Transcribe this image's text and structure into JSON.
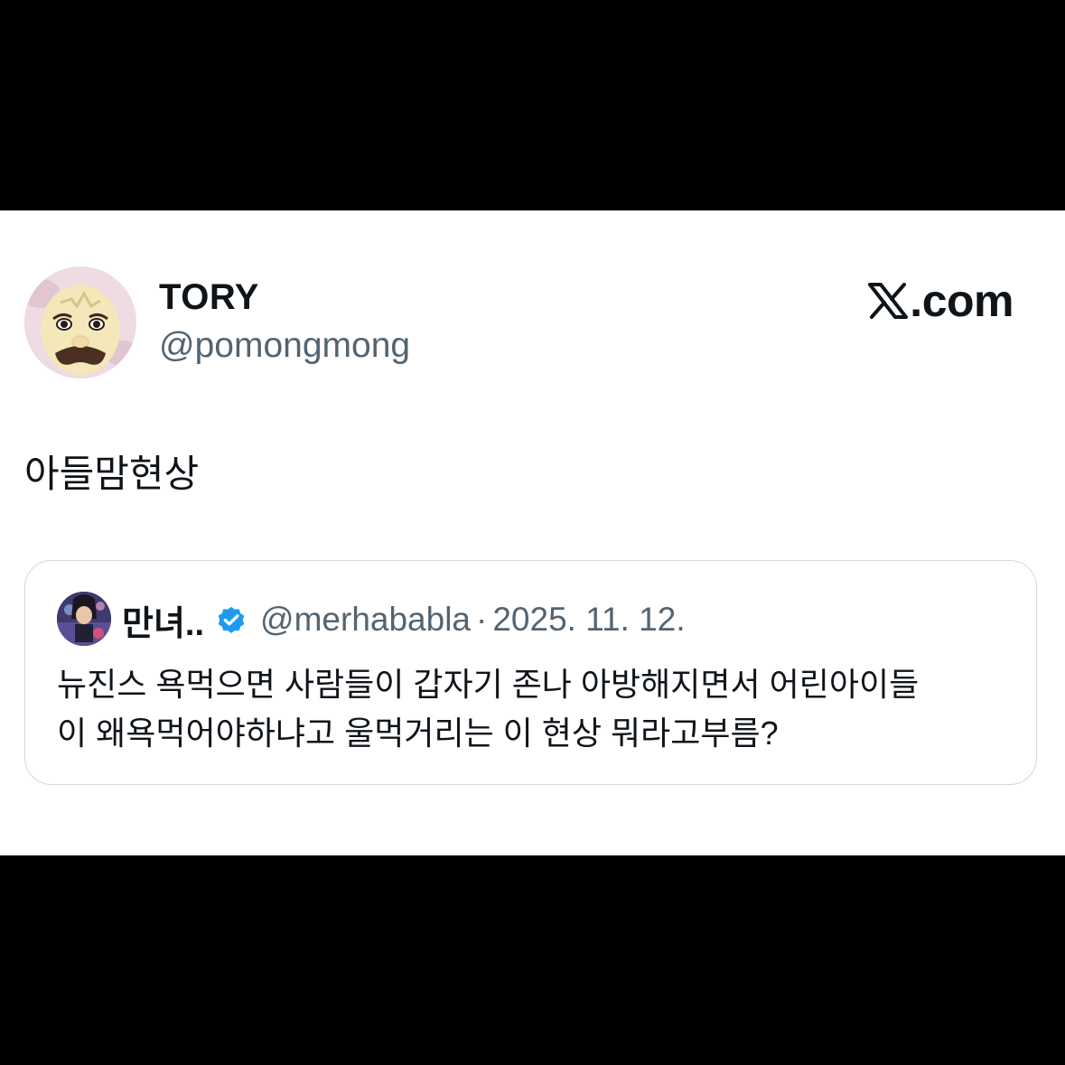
{
  "tweet": {
    "display_name": "TORY",
    "handle": "@pomongmong",
    "text": "아들맘현상",
    "brand": ".com",
    "brand_icon": "x-logo-icon"
  },
  "quoted_tweet": {
    "display_name": "만녀..",
    "verified": true,
    "handle": "@merhababla",
    "separator": "·",
    "date": "2025. 11. 12.",
    "text_lines": [
      "뉴진스 욕먹으면 사람들이 갑자기 존나 아방해지면서 어린아이들",
      "이 왜욕먹어야하냐고 울먹거리는 이 현상 뭐라고부름?"
    ]
  },
  "colors": {
    "background": "#000000",
    "card": "#ffffff",
    "text_primary": "#0f1419",
    "text_secondary": "#536471",
    "verified_badge": "#1d9bf0",
    "border": "#cfd9de"
  }
}
